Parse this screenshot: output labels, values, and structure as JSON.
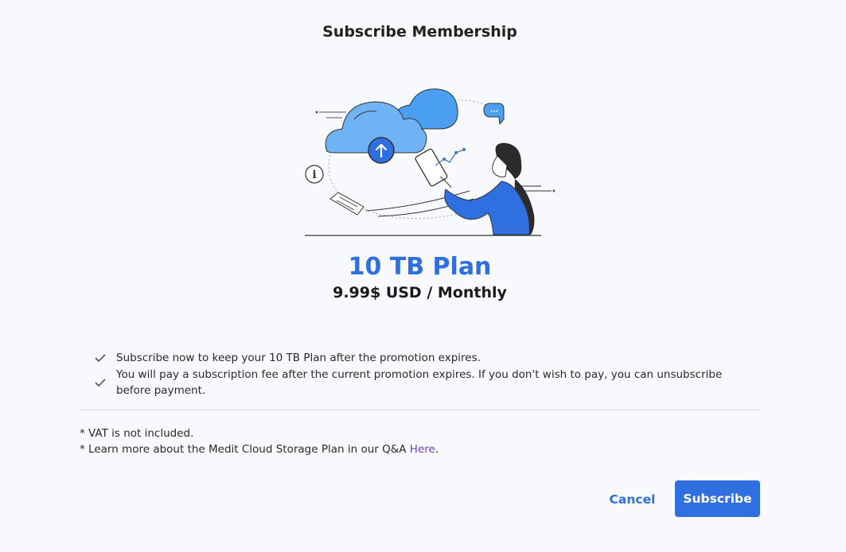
{
  "dialog": {
    "title": "Subscribe Membership"
  },
  "plan": {
    "name": "10 TB Plan",
    "price": "9.99$ USD / Monthly"
  },
  "benefits": [
    "Subscribe now to keep your 10 TB Plan after the promotion expires.",
    "You will pay a subscription fee after the current promotion expires. If you don't wish to pay, you can unsubscribe before payment."
  ],
  "notes": {
    "vat": "* VAT is not included.",
    "learn_more_prefix": "* Learn more about the Medit Cloud Storage Plan in our Q&A ",
    "learn_more_link": "Here",
    "learn_more_suffix": "."
  },
  "buttons": {
    "cancel": "Cancel",
    "subscribe": "Subscribe"
  },
  "colors": {
    "accent": "#2f6fe0",
    "link": "#6a3fbf",
    "background": "#f7f9fc",
    "cloud_light": "#6fb3f5",
    "cloud_dark": "#4a9ff0"
  },
  "icons": {
    "benefit": "check-icon",
    "upload": "arrow-up-icon",
    "info": "info-icon",
    "chat": "chat-bubble-icon"
  }
}
